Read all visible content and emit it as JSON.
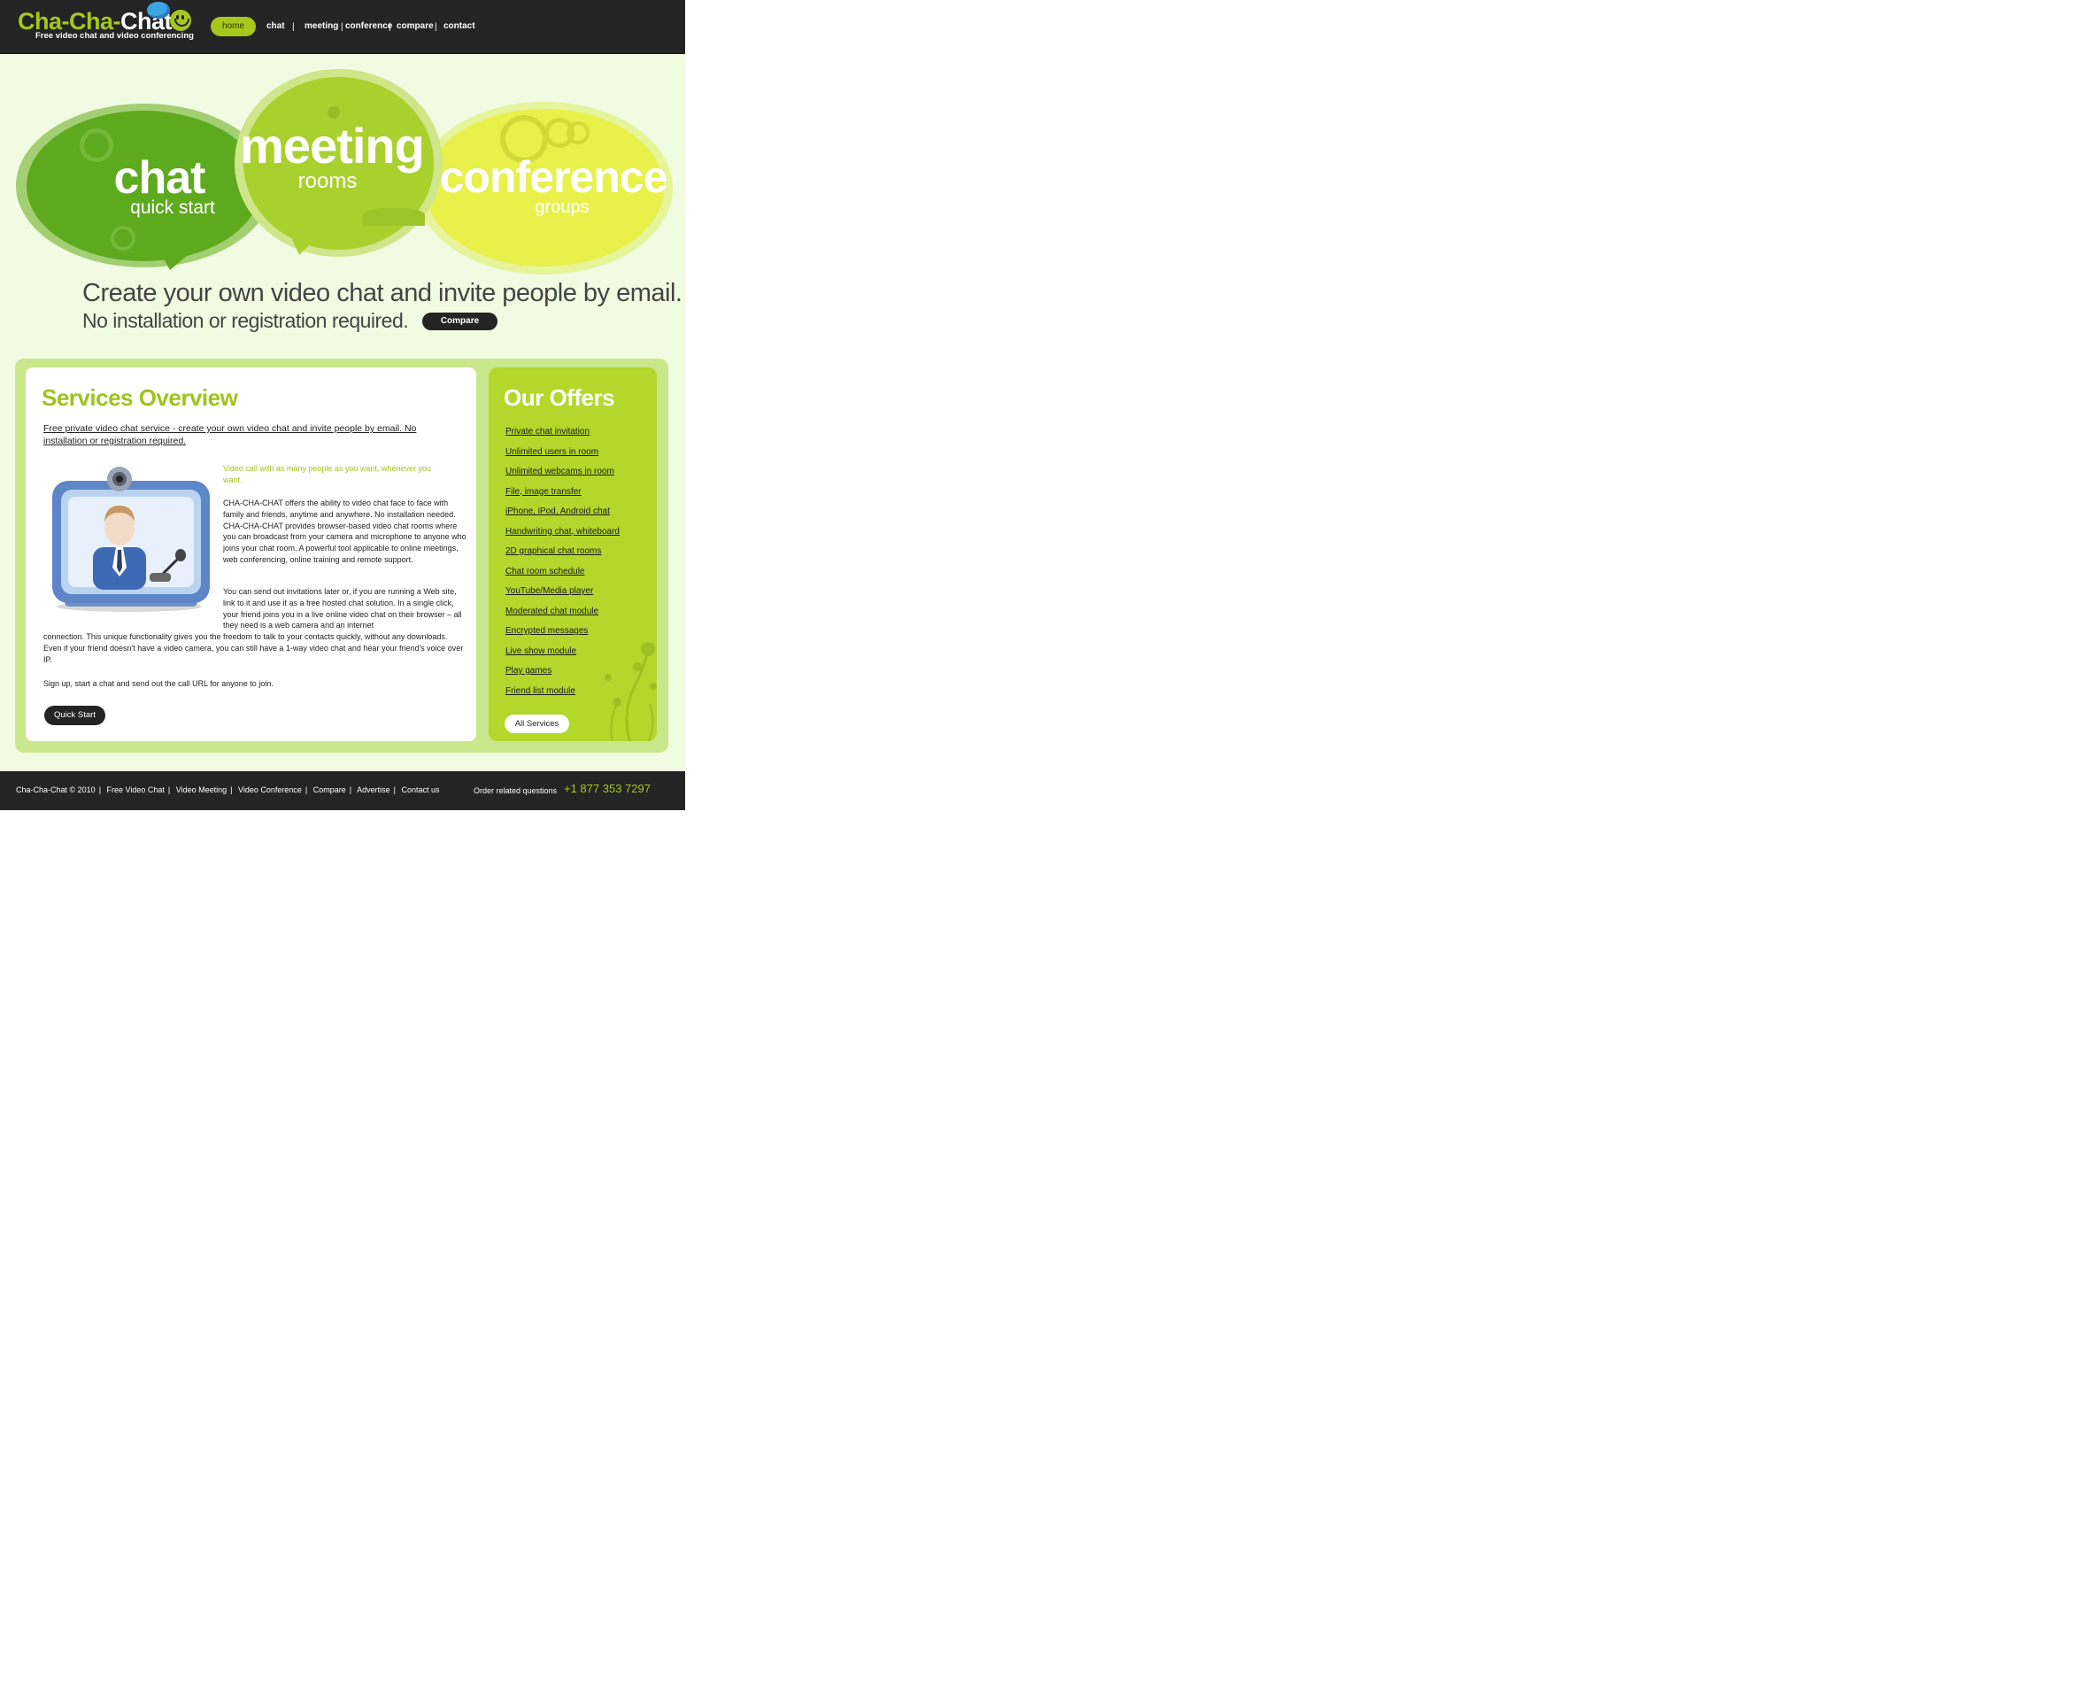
{
  "header": {
    "logo": {
      "part1": "Cha-Cha-",
      "part2": "Chat",
      "tagline": "Free video chat and video conferencing"
    },
    "nav": [
      {
        "label": "home"
      },
      {
        "label": "chat"
      },
      {
        "label": "meeting"
      },
      {
        "label": "conference"
      },
      {
        "label": "compare"
      },
      {
        "label": "contact"
      }
    ],
    "separator": "|"
  },
  "hero": {
    "chat": {
      "title": "chat",
      "subtitle": "quick start"
    },
    "meeting": {
      "title": "meeting",
      "subtitle": "rooms"
    },
    "conference": {
      "title": "conference",
      "subtitle": "groups"
    },
    "tagline_line1": "Create your own video chat and invite people by email.",
    "tagline_line2": "No installation or registration required.",
    "compare_button": "Compare"
  },
  "services": {
    "title": "Services Overview",
    "intro": "Free private video chat service - create your own video chat and invite people by email. No installation or registration required.",
    "accent": "Video call with as many people as you want, whenever you want.",
    "paragraph1": "CHA-CHA-CHAT offers the ability to video chat face to face with family and friends, anytime and anywhere. No installation needed. CHA-CHA-CHAT provides browser-based video chat rooms where you can broadcast from your camera and microphone to anyone who joins your chat room. A powerful tool applicable to online meetings, web conferencing, online training and remote support.",
    "paragraph2a": "You can send out invitations later or, if you are running a Web site, link to it and use it as a free hosted chat solution. In a single click, your friend joins you in a live online video chat on their browser – all they need is a web camera and an internet",
    "paragraph2b": "connection. This unique functionality gives you the freedom to talk to your contacts quickly, without any downloads. Even if your friend doesn't have a video camera, you can still have a 1-way video chat and hear your friend's voice over IP.",
    "paragraph3": "Sign up, start a chat and send out the call URL for anyone to join.",
    "quick_start_button": "Quick Start"
  },
  "offers": {
    "title": "Our Offers",
    "items": [
      "Private chat invitation",
      "Unlimited users in room",
      "Unlimited webcams in room",
      "File, image transfer",
      "iPhone, iPod, Android chat",
      "Handwriting chat, whiteboard",
      "2D graphical chat rooms",
      "Chat room schedule",
      "YouTube/Media player",
      "Moderated chat module",
      "Encrypted messages",
      "Live show module",
      "Play games",
      "Friend list module"
    ],
    "all_services_button": "All Services"
  },
  "footer": {
    "copyright": "Cha-Cha-Chat © 2010",
    "links": [
      "Free Video Chat",
      "Video Meeting",
      "Video Conference",
      "Compare",
      "Advertise",
      "Contact us"
    ],
    "order_label": "Order related questions",
    "phone": "+1 877 353 7297"
  },
  "colors": {
    "accent": "#a6c71c",
    "dark": "#242424",
    "background": "#f1fbe2",
    "panel": "#c9e78b"
  }
}
